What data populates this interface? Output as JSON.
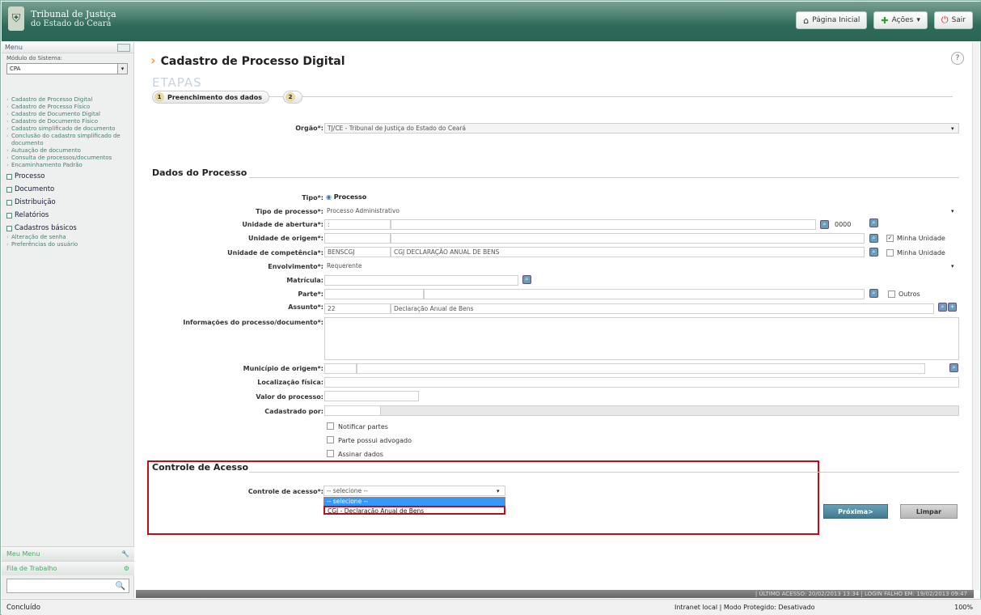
{
  "header": {
    "logo_line1": "Tribunal de Justiça",
    "logo_line2": "do Estado do Ceará",
    "btn_home": "Página Inicial",
    "btn_actions": "Ações",
    "btn_exit": "Sair"
  },
  "sidebar": {
    "menu_label": "Menu",
    "module_label": "Módulo do Sistema:",
    "module_value": "CPA",
    "links": [
      "Cadastro de Processo Digital",
      "Cadastro de Processo Físico",
      "Cadastro de Documento Digital",
      "Cadastro de Documento Físico",
      "Cadastro simplificado de documento",
      "Conclusão do cadastro simplificado de documento",
      "Autuação de documento",
      "Consulta de processos/documentos",
      "Encaminhamento Padrão"
    ],
    "sections": [
      "Processo",
      "Documento",
      "Distribuição",
      "Relatórios",
      "Cadastros básicos"
    ],
    "extra_links": [
      "Alteração de senha",
      "Preferências do usuário"
    ],
    "meu_menu": "Meu Menu",
    "fila": "Fila de Trabalho"
  },
  "main": {
    "title": "Cadastro de Processo Digital",
    "help": "?",
    "etapas": "ETAPAS",
    "step1_num": "1",
    "step1_label": "Preenchimento dos dados",
    "step2_num": "2",
    "orgao_label": "Orgão*:",
    "orgao_value": "TJ/CE - Tribunal de Justiça do Estado do Ceará",
    "dados_header": "Dados do Processo",
    "tipo_label": "Tipo*:",
    "tipo_value": "Processo",
    "tipo_processo_label": "Tipo de processo*:",
    "tipo_processo_value": "Processo Administrativo",
    "unidade_abertura_label": "Unidade de abertura*:",
    "unidade_abertura_value": ":",
    "unidade_abertura_code": "0000",
    "unidade_origem_label": "Unidade de origem*:",
    "minha_unidade_1": "Minha Unidade",
    "unidade_competencia_label": "Unidade de competência*:",
    "unidade_competencia_code": "BENSCGJ",
    "unidade_competencia_value": "CGJ DECLARAÇÃO ANUAL DE BENS",
    "minha_unidade_2": "Minha Unidade",
    "envolvimento_label": "Envolvimento*:",
    "envolvimento_value": "Requerente",
    "matricula_label": "Matrícula:",
    "parte_label": "Parte*:",
    "outros": "Outros",
    "assunto_label": "Assunto*:",
    "assunto_code": "22",
    "assunto_value": "Declaração Anual de Bens",
    "info_label": "Informações do processo/documento*:",
    "municipio_label": "Município de origem*:",
    "localizacao_label": "Localização física:",
    "valor_label": "Valor do processo:",
    "cadastrado_label": "Cadastrado por:",
    "chk_notificar": "Notificar partes",
    "chk_advogado": "Parte possui advogado",
    "chk_assinar": "Assinar dados",
    "controle_header": "Controle de Acesso",
    "controle_label": "Controle de acesso*:",
    "controle_value": "-- selecione --",
    "dropdown_options": [
      "-- selecione --",
      "CGJ - Declaração Anual de Bens"
    ],
    "btn_proxima": "Próxima>",
    "btn_limpar": "Limpar"
  },
  "footer_strip": "| ÚLTIMO ACESSO: 20/02/2013 13:34 | LOGIN FALHO EM: 19/02/2013 09:47",
  "statusbar": {
    "status": "Concluído",
    "zone": "Intranet local | Modo Protegido: Desativado",
    "zoom": "100%"
  }
}
